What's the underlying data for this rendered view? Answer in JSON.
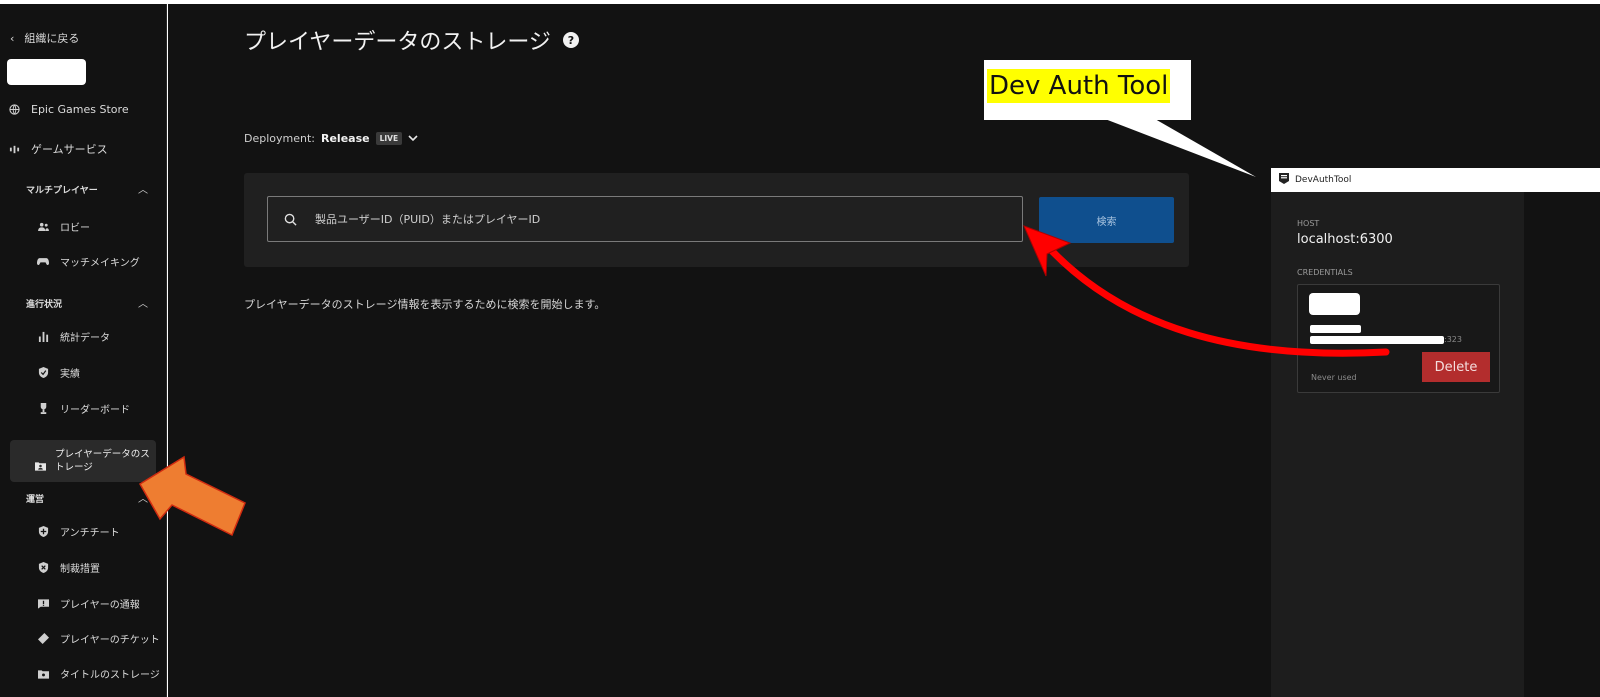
{
  "sidebar": {
    "back_label": "組織に戻る",
    "store_label": "Epic Games Store",
    "game_services_label": "ゲームサービス",
    "sections": {
      "multiplayer": "マルチプレイヤー",
      "progress": "進行状況",
      "operations": "運営"
    },
    "items": {
      "lobby": "ロビー",
      "matchmaking": "マッチメイキング",
      "stats": "統計データ",
      "achievements": "実績",
      "leaderboards": "リーダーボード",
      "player_data_storage": "プレイヤーデータのストレージ",
      "anticheat": "アンチチート",
      "sanctions": "制裁措置",
      "player_reports": "プレイヤーの通報",
      "player_tickets": "プレイヤーのチケット",
      "title_storage": "タイトルのストレージ"
    }
  },
  "main": {
    "title": "プレイヤーデータのストレージ",
    "help_glyph": "?",
    "deployment_label": "Deployment:",
    "deployment_value": "Release",
    "deployment_badge": "LIVE",
    "search_placeholder": "製品ユーザーID（PUID）またはプレイヤーID",
    "search_button": "検索",
    "hint": "プレイヤーデータのストレージ情報を表示するために検索を開始します。"
  },
  "callout": {
    "text": "Dev Auth Tool"
  },
  "devauthtool": {
    "window_title": "DevAuthTool",
    "host_label": "HOST",
    "host_value": "localhost:6300",
    "credentials_label": "CREDENTIALS",
    "port_suffix": ":323",
    "never_used": "Never used",
    "delete_button": "Delete"
  },
  "colors": {
    "background": "#121212",
    "panel": "#202020",
    "search_button": "#0f4f8e",
    "delete_button": "#b32d2d",
    "highlight": "#ffff00",
    "annotation_red": "#ff0000",
    "annotation_orange": "#ee7d31"
  }
}
